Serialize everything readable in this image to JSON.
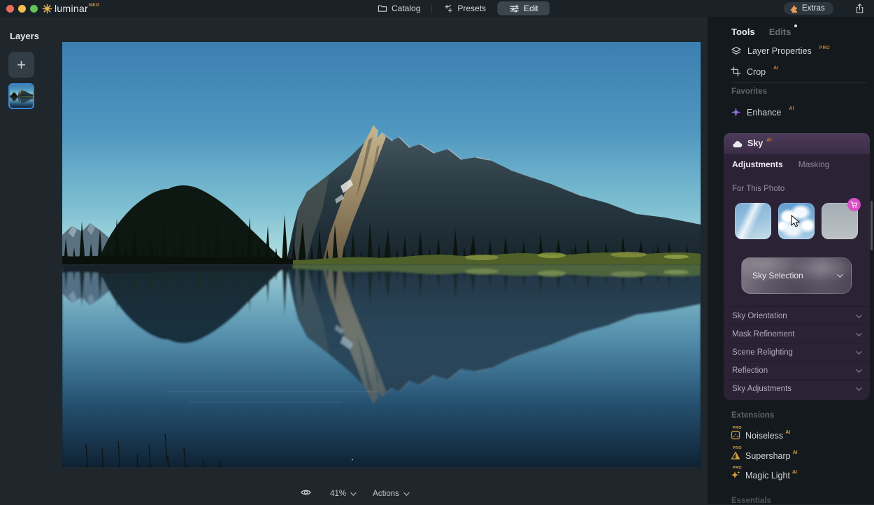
{
  "window": {
    "app_name": "luminar",
    "app_suffix": "NEO"
  },
  "titlebar": {
    "tabs": [
      {
        "label": "Catalog",
        "icon": "folder-icon"
      },
      {
        "label": "Presets",
        "icon": "sparkle-icon"
      },
      {
        "label": "Edit",
        "icon": "sliders-icon",
        "active": true
      }
    ],
    "extras_label": "Extras"
  },
  "layers_panel": {
    "title": "Layers"
  },
  "statusbar": {
    "zoom_level": "41%",
    "actions_label": "Actions"
  },
  "side_panel": {
    "tools_tab": "Tools",
    "edits_tab": "Edits",
    "layer_properties": {
      "label": "Layer Properties",
      "badge": "PRO"
    },
    "crop": {
      "label": "Crop",
      "badge": "AI"
    },
    "favorites_header": "Favorites",
    "enhance": {
      "label": "Enhance",
      "badge": "AI"
    },
    "sky": {
      "title": "Sky",
      "badge": "AI",
      "tab_adjustments": "Adjustments",
      "tab_masking": "Masking",
      "section_label": "For This Photo",
      "thumbnails": [
        {
          "name": "wispy-clouds-sky"
        },
        {
          "name": "cumulus-clouds-sky"
        },
        {
          "name": "premium-sky",
          "has_cart_badge": true
        }
      ],
      "dropdown_label": "Sky Selection",
      "sections": [
        {
          "label": "Sky Orientation"
        },
        {
          "label": "Mask Refinement"
        },
        {
          "label": "Scene Relighting"
        },
        {
          "label": "Reflection"
        },
        {
          "label": "Sky Adjustments"
        }
      ]
    },
    "extensions_header": "Extensions",
    "extensions": [
      {
        "label": "Noiseless",
        "pro": "PRO",
        "badge": "AI"
      },
      {
        "label": "Supersharp",
        "pro": "PRO",
        "badge": "AI"
      },
      {
        "label": "Magic Light",
        "pro": "PRO",
        "badge": "AI"
      }
    ],
    "essentials_header": "Essentials"
  },
  "colors": {
    "traffic_red": "#ee6a5f",
    "traffic_yellow": "#f5bd4f",
    "traffic_green": "#62c454",
    "accent_ai_orange": "#cf7e36",
    "pro_gold": "#c08530",
    "extension_gold": "#d8a53f",
    "sky_panel_purple": "#2b2236",
    "sky_header_purple": "#4e3c5a",
    "cart_pink": "#d84fc6",
    "selected_layer_blue": "#3f87d6",
    "logo_gold": "#eab64d",
    "enhance_purple": "#9468dd"
  }
}
